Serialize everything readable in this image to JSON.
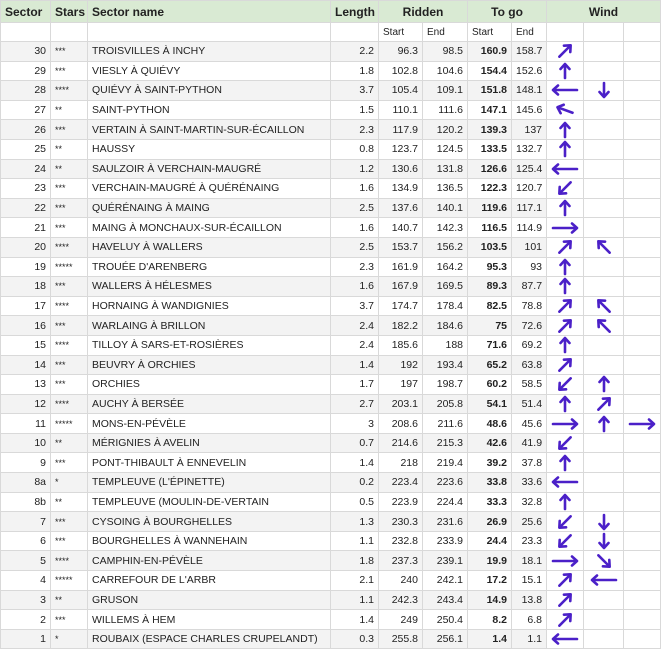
{
  "headers": {
    "sector": "Sector",
    "stars": "Stars",
    "name": "Sector name",
    "length": "Length",
    "ridden": "Ridden",
    "togo": "To go",
    "wind": "Wind",
    "start": "Start",
    "end": "End"
  },
  "arrow_color": "#4b20c8",
  "rows": [
    {
      "sector": "30",
      "stars": "***",
      "name": "Troisvilles à Inchy",
      "length": "2.2",
      "r_start": "96.3",
      "r_end": "98.5",
      "g_start": "160.9",
      "g_end": "158.7",
      "wind": [
        "up-right-thin",
        "",
        ""
      ]
    },
    {
      "sector": "29",
      "stars": "***",
      "name": "Viesly à Quiévy",
      "length": "1.8",
      "r_start": "102.8",
      "r_end": "104.6",
      "g_start": "154.4",
      "g_end": "152.6",
      "wind": [
        "up",
        "",
        ""
      ]
    },
    {
      "sector": "28",
      "stars": "****",
      "name": "Quiévy à Saint-Python",
      "length": "3.7",
      "r_start": "105.4",
      "r_end": "109.1",
      "g_start": "151.8",
      "g_end": "148.1",
      "wind": [
        "left",
        "down",
        ""
      ]
    },
    {
      "sector": "27",
      "stars": "**",
      "name": "Saint-Python",
      "length": "1.5",
      "r_start": "110.1",
      "r_end": "111.6",
      "g_start": "147.1",
      "g_end": "145.6",
      "wind": [
        "left-up",
        "",
        ""
      ]
    },
    {
      "sector": "26",
      "stars": "***",
      "name": "Vertain à Saint-Martin-sur-Écaillon",
      "length": "2.3",
      "r_start": "117.9",
      "r_end": "120.2",
      "g_start": "139.3",
      "g_end": "137",
      "wind": [
        "up",
        "",
        ""
      ]
    },
    {
      "sector": "25",
      "stars": "**",
      "name": "Haussy",
      "length": "0.8",
      "r_start": "123.7",
      "r_end": "124.5",
      "g_start": "133.5",
      "g_end": "132.7",
      "wind": [
        "up",
        "",
        ""
      ]
    },
    {
      "sector": "24",
      "stars": "**",
      "name": "Saulzoir à Verchain-Maugré",
      "length": "1.2",
      "r_start": "130.6",
      "r_end": "131.8",
      "g_start": "126.6",
      "g_end": "125.4",
      "wind": [
        "left",
        "",
        ""
      ]
    },
    {
      "sector": "23",
      "stars": "***",
      "name": "Verchain-Maugré à Quérénaing",
      "length": "1.6",
      "r_start": "134.9",
      "r_end": "136.5",
      "g_start": "122.3",
      "g_end": "120.7",
      "wind": [
        "down-left",
        "",
        ""
      ]
    },
    {
      "sector": "22",
      "stars": "***",
      "name": "Quérénaing à Maing",
      "length": "2.5",
      "r_start": "137.6",
      "r_end": "140.1",
      "g_start": "119.6",
      "g_end": "117.1",
      "wind": [
        "up",
        "",
        ""
      ]
    },
    {
      "sector": "21",
      "stars": "***",
      "name": "Maing à Monchaux-sur-Écaillon",
      "length": "1.6",
      "r_start": "140.7",
      "r_end": "142.3",
      "g_start": "116.5",
      "g_end": "114.9",
      "wind": [
        "right",
        "",
        ""
      ]
    },
    {
      "sector": "20",
      "stars": "****",
      "name": "Haveluy à Wallers",
      "length": "2.5",
      "r_start": "153.7",
      "r_end": "156.2",
      "g_start": "103.5",
      "g_end": "101",
      "wind": [
        "up-right",
        "up-left",
        ""
      ]
    },
    {
      "sector": "19",
      "stars": "*****",
      "name": "Trouée d'Arenberg",
      "length": "2.3",
      "r_start": "161.9",
      "r_end": "164.2",
      "g_start": "95.3",
      "g_end": "93",
      "wind": [
        "up",
        "",
        ""
      ]
    },
    {
      "sector": "18",
      "stars": "***",
      "name": "Wallers à Hélesmes",
      "length": "1.6",
      "r_start": "167.9",
      "r_end": "169.5",
      "g_start": "89.3",
      "g_end": "87.7",
      "wind": [
        "up",
        "",
        ""
      ]
    },
    {
      "sector": "17",
      "stars": "****",
      "name": "Hornaing à Wandignies",
      "length": "3.7",
      "r_start": "174.7",
      "r_end": "178.4",
      "g_start": "82.5",
      "g_end": "78.8",
      "wind": [
        "up-right",
        "up-left",
        ""
      ]
    },
    {
      "sector": "16",
      "stars": "***",
      "name": "Warlaing à Brillon",
      "length": "2.4",
      "r_start": "182.2",
      "r_end": "184.6",
      "g_start": "75",
      "g_end": "72.6",
      "wind": [
        "up-right",
        "up-left",
        ""
      ]
    },
    {
      "sector": "15",
      "stars": "****",
      "name": "Tilloy à Sars-et-Rosières",
      "length": "2.4",
      "r_start": "185.6",
      "r_end": "188",
      "g_start": "71.6",
      "g_end": "69.2",
      "wind": [
        "up",
        "",
        ""
      ]
    },
    {
      "sector": "14",
      "stars": "***",
      "name": "Beuvry à Orchies",
      "length": "1.4",
      "r_start": "192",
      "r_end": "193.4",
      "g_start": "65.2",
      "g_end": "63.8",
      "wind": [
        "up-right",
        "",
        ""
      ]
    },
    {
      "sector": "13",
      "stars": "***",
      "name": "Orchies",
      "length": "1.7",
      "r_start": "197",
      "r_end": "198.7",
      "g_start": "60.2",
      "g_end": "58.5",
      "wind": [
        "down-left",
        "up",
        ""
      ]
    },
    {
      "sector": "12",
      "stars": "****",
      "name": "Auchy à Bersée",
      "length": "2.7",
      "r_start": "203.1",
      "r_end": "205.8",
      "g_start": "54.1",
      "g_end": "51.4",
      "wind": [
        "up",
        "up-right",
        ""
      ]
    },
    {
      "sector": "11",
      "stars": "*****",
      "name": "Mons-en-Pévèle",
      "length": "3",
      "r_start": "208.6",
      "r_end": "211.6",
      "g_start": "48.6",
      "g_end": "45.6",
      "wind": [
        "right",
        "up",
        "right"
      ]
    },
    {
      "sector": "10",
      "stars": "**",
      "name": "Mérignies à Avelin",
      "length": "0.7",
      "r_start": "214.6",
      "r_end": "215.3",
      "g_start": "42.6",
      "g_end": "41.9",
      "wind": [
        "down-left",
        "",
        ""
      ]
    },
    {
      "sector": "9",
      "stars": "***",
      "name": "Pont-Thibault à Ennevelin",
      "length": "1.4",
      "r_start": "218",
      "r_end": "219.4",
      "g_start": "39.2",
      "g_end": "37.8",
      "wind": [
        "up",
        "",
        ""
      ]
    },
    {
      "sector": "8a",
      "stars": "*",
      "name": "Templeuve (L'Épinette)",
      "length": "0.2",
      "r_start": "223.4",
      "r_end": "223.6",
      "g_start": "33.8",
      "g_end": "33.6",
      "wind": [
        "left",
        "",
        ""
      ]
    },
    {
      "sector": "8b",
      "stars": "**",
      "name": "Templeuve (Moulin-de-Vertain",
      "length": "0.5",
      "r_start": "223.9",
      "r_end": "224.4",
      "g_start": "33.3",
      "g_end": "32.8",
      "wind": [
        "up",
        "",
        ""
      ]
    },
    {
      "sector": "7",
      "stars": "***",
      "name": "Cysoing à Bourghelles",
      "length": "1.3",
      "r_start": "230.3",
      "r_end": "231.6",
      "g_start": "26.9",
      "g_end": "25.6",
      "wind": [
        "down-left",
        "down",
        ""
      ]
    },
    {
      "sector": "6",
      "stars": "***",
      "name": "Bourghelles à Wannehain",
      "length": "1.1",
      "r_start": "232.8",
      "r_end": "233.9",
      "g_start": "24.4",
      "g_end": "23.3",
      "wind": [
        "down-left",
        "down",
        ""
      ]
    },
    {
      "sector": "5",
      "stars": "****",
      "name": "Camphin-en-Pévèle",
      "length": "1.8",
      "r_start": "237.3",
      "r_end": "239.1",
      "g_start": "19.9",
      "g_end": "18.1",
      "wind": [
        "right",
        "down-right",
        ""
      ]
    },
    {
      "sector": "4",
      "stars": "*****",
      "name": "Carrefour de l'Arbr",
      "length": "2.1",
      "r_start": "240",
      "r_end": "242.1",
      "g_start": "17.2",
      "g_end": "15.1",
      "wind": [
        "up-right",
        "left",
        ""
      ]
    },
    {
      "sector": "3",
      "stars": "**",
      "name": "Gruson",
      "length": "1.1",
      "r_start": "242.3",
      "r_end": "243.4",
      "g_start": "14.9",
      "g_end": "13.8",
      "wind": [
        "up-right",
        "",
        ""
      ]
    },
    {
      "sector": "2",
      "stars": "***",
      "name": "Willems à Hem",
      "length": "1.4",
      "r_start": "249",
      "r_end": "250.4",
      "g_start": "8.2",
      "g_end": "6.8",
      "wind": [
        "up-right",
        "",
        ""
      ]
    },
    {
      "sector": "1",
      "stars": "*",
      "name": "Roubaix (Espace Charles Crupelandt)",
      "length": "0.3",
      "r_start": "255.8",
      "r_end": "256.1",
      "g_start": "1.4",
      "g_end": "1.1",
      "wind": [
        "left",
        "",
        ""
      ]
    }
  ]
}
